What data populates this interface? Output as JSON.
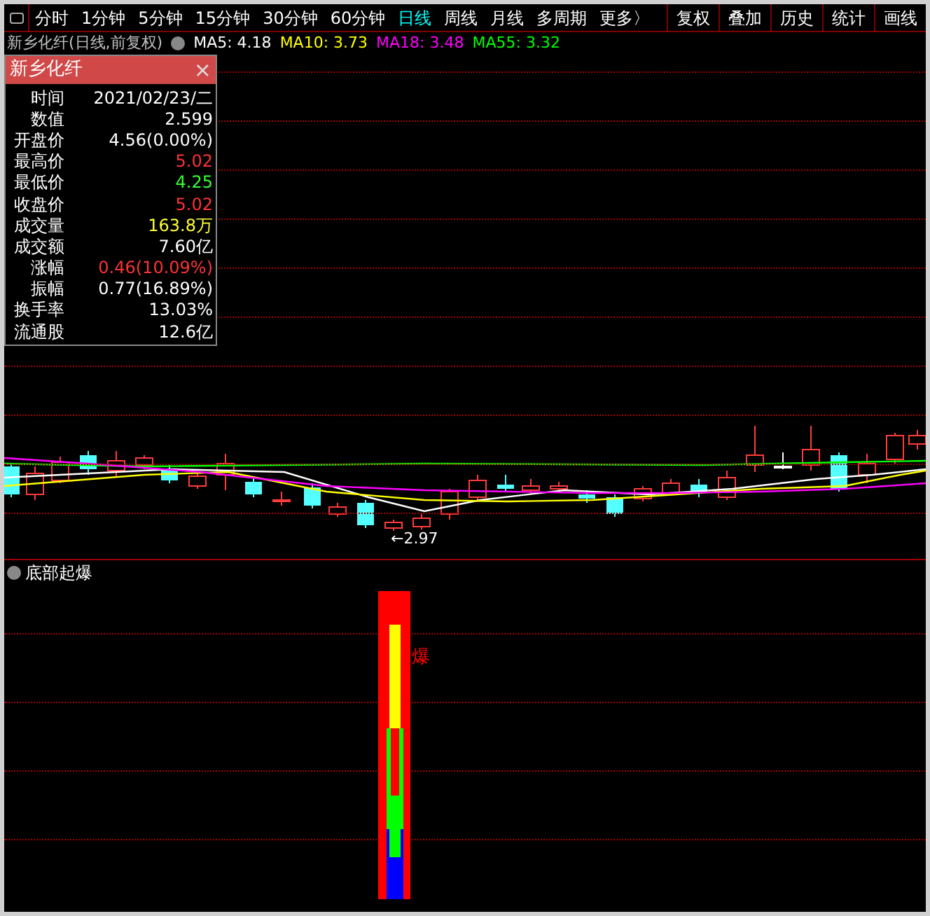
{
  "toolbar": {
    "tabs": [
      {
        "label": "分时",
        "selected": false
      },
      {
        "label": "1分钟",
        "selected": false
      },
      {
        "label": "5分钟",
        "selected": false
      },
      {
        "label": "15分钟",
        "selected": false
      },
      {
        "label": "30分钟",
        "selected": false
      },
      {
        "label": "60分钟",
        "selected": false
      },
      {
        "label": "日线",
        "selected": true
      },
      {
        "label": "周线",
        "selected": false
      },
      {
        "label": "月线",
        "selected": false
      },
      {
        "label": "多周期",
        "selected": false
      },
      {
        "label": "更多〉",
        "selected": false
      }
    ],
    "buttons": [
      "复权",
      "叠加",
      "历史",
      "统计",
      "画线"
    ]
  },
  "chart_header": {
    "title": "新乡化纤(日线,前复权)",
    "indicators": [
      {
        "label": "MA5: 4.18",
        "color": "#ffffff"
      },
      {
        "label": "MA10: 3.73",
        "color": "#ffff00"
      },
      {
        "label": "MA18: 3.48",
        "color": "#ff00ff"
      },
      {
        "label": "MA55: 3.32",
        "color": "#00ff00"
      }
    ]
  },
  "info_popup": {
    "title": "新乡化纤",
    "close": "×",
    "rows": [
      {
        "label": "时间",
        "value": "2021/02/23/二",
        "color": "#ffffff"
      },
      {
        "label": "数值",
        "value": "2.599",
        "color": "#ffffff"
      },
      {
        "label": "开盘价",
        "value": "4.56(0.00%)",
        "color": "#ffffff"
      },
      {
        "label": "最高价",
        "value": "5.02",
        "color": "#ff3333"
      },
      {
        "label": "最低价",
        "value": "4.25",
        "color": "#33ff33"
      },
      {
        "label": "收盘价",
        "value": "5.02",
        "color": "#ff3333"
      },
      {
        "label": "成交量",
        "value": "163.8万",
        "color": "#ffff33"
      },
      {
        "label": "成交额",
        "value": "7.60亿",
        "color": "#ffffff"
      },
      {
        "label": "涨幅",
        "value": "0.46(10.09%)",
        "color": "#ff3333"
      },
      {
        "label": "振幅",
        "value": "0.77(16.89%)",
        "color": "#ffffff"
      },
      {
        "label": "换手率",
        "value": "13.03%",
        "color": "#ffffff"
      },
      {
        "label": "流通股",
        "value": "12.6亿",
        "color": "#ffffff"
      }
    ]
  },
  "main_chart": {
    "low_marker": "←2.97"
  },
  "indicator_panel": {
    "title": "底部起爆",
    "signal_label": "爆"
  }
}
